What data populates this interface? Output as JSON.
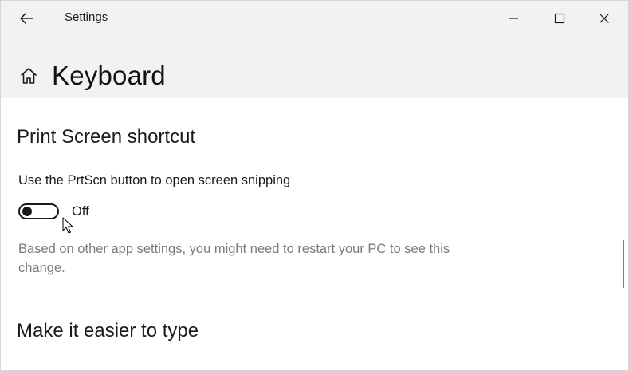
{
  "window": {
    "title": "Settings"
  },
  "titlebar": {
    "back_icon": "back-arrow-icon",
    "minimize_icon": "minimize-icon",
    "maximize_icon": "maximize-icon",
    "close_icon": "close-icon"
  },
  "header": {
    "icon": "home-icon",
    "title": "Keyboard"
  },
  "print_screen_section": {
    "title": "Print Screen shortcut",
    "setting_label": "Use the PrtScn button to open screen snipping",
    "toggle_state": "Off",
    "toggle_on": false,
    "hint": "Based on other app settings, you might need to restart your PC to see this change."
  },
  "typing_section": {
    "title": "Make it easier to type"
  },
  "colors": {
    "header_background": "#f2f2f2",
    "text": "#1a1a1a",
    "hint_text": "#7a7a7a"
  }
}
